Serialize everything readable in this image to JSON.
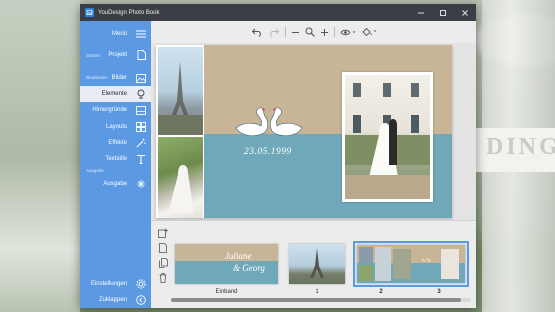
{
  "window": {
    "title": "YouDesign Photo Book"
  },
  "sidebar": {
    "menu_label": "Menü",
    "sections": {
      "start": "Starten",
      "edit": "Bearbeiten",
      "output": "Ausgabe"
    },
    "items": [
      {
        "label": "Projekt",
        "icon": "page-icon",
        "active": false
      },
      {
        "label": "Bilder",
        "icon": "image-icon",
        "active": false
      },
      {
        "label": "Elemente",
        "icon": "elements-icon",
        "active": true
      },
      {
        "label": "Hintergründe",
        "icon": "background-icon",
        "active": false
      },
      {
        "label": "Layouts",
        "icon": "layout-icon",
        "active": false
      },
      {
        "label": "Effekte",
        "icon": "effects-wand-icon",
        "active": false
      },
      {
        "label": "Textstile",
        "icon": "text-style-icon",
        "active": false
      },
      {
        "label": "Ausgabe",
        "icon": "output-icon",
        "active": false
      }
    ],
    "settings_label": "Einstellungen",
    "collapse_label": "Zuklappen"
  },
  "canvas": {
    "date_text": "23.05.1999"
  },
  "thumbnails": {
    "cover_text_line1": "Juliane",
    "cover_text_line2": "& Georg",
    "labels": [
      "Einband",
      "1",
      "2",
      "3"
    ],
    "selected_index": 2
  },
  "colors": {
    "sidebar": "#5b99e3",
    "titlebar": "#3b3f45",
    "tan": "#c8b597",
    "teal": "#6fa8b8"
  }
}
